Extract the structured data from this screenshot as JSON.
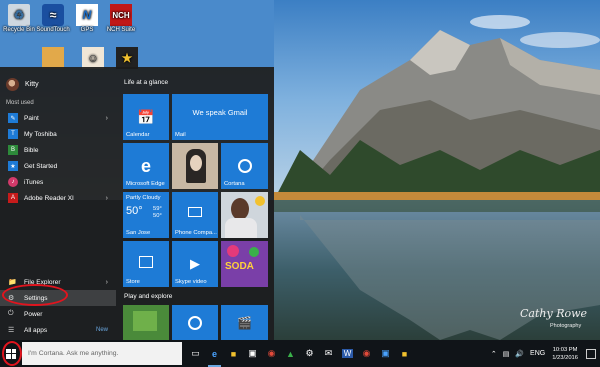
{
  "desktop": {
    "icons": [
      {
        "label": "Recycle Bin",
        "icon": "recycle-bin-icon"
      },
      {
        "label": "SoundTouch",
        "icon": "soundtouch-icon"
      },
      {
        "label": "GPS",
        "icon": "gps-icon"
      },
      {
        "label": "NCH Suite",
        "icon": "nch-icon"
      }
    ],
    "signature": "Cathy Rowe",
    "photography": "Photography"
  },
  "start_menu": {
    "user_name": "Kitty",
    "most_used_label": "Most used",
    "apps": [
      {
        "label": "Paint",
        "icon": "paint-icon",
        "color": "#1e7bd6",
        "has_arrow": true
      },
      {
        "label": "My Toshiba",
        "icon": "toshiba-icon",
        "color": "#1e7bd6",
        "has_arrow": false
      },
      {
        "label": "Bible",
        "icon": "bible-icon",
        "color": "#2d8a3a",
        "has_arrow": false
      },
      {
        "label": "Get Started",
        "icon": "get-started-icon",
        "color": "#1e7bd6",
        "has_arrow": false
      },
      {
        "label": "iTunes",
        "icon": "itunes-icon",
        "color": "#d23a6a",
        "has_arrow": false
      },
      {
        "label": "Adobe Reader XI",
        "icon": "adobe-reader-icon",
        "color": "#c61b1b",
        "has_arrow": true
      }
    ],
    "file_explorer": "File Explorer",
    "settings": "Settings",
    "power": "Power",
    "all_apps": "All apps",
    "new_badge": "New",
    "groups": {
      "life": "Life at a glance",
      "play": "Play and explore"
    },
    "tiles": {
      "calendar": "Calendar",
      "mail_headline": "We speak Gmail",
      "mail": "Mail",
      "edge": "Microsoft Edge",
      "cortana": "Cortana",
      "weather_cond": "Partly Cloudy",
      "weather_temp": "50°",
      "weather_high": "59°",
      "weather_low": "50°",
      "weather_city": "San Jose",
      "phone": "Phone Compa...",
      "store": "Store",
      "skype": "Skype video",
      "candy": "SODA"
    }
  },
  "taskbar": {
    "search_placeholder": "I'm Cortana. Ask me anything.",
    "language": "ENG",
    "time": "10:03 PM",
    "date": "1/23/2016"
  }
}
